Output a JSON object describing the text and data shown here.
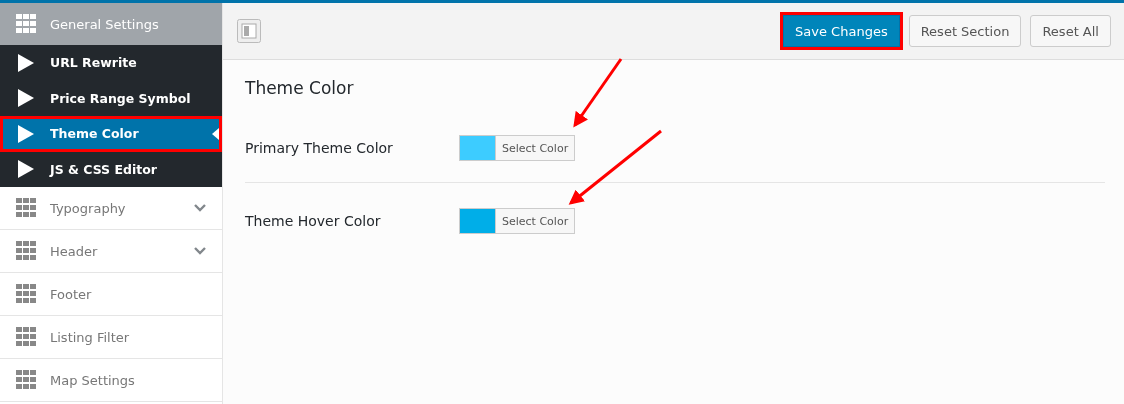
{
  "sidebar": {
    "sections": [
      {
        "label": "General Settings",
        "expanded": true,
        "has_submenu": true,
        "children": [
          {
            "label": "URL Rewrite",
            "selected": false,
            "highlighted": false
          },
          {
            "label": "Price Range Symbol",
            "selected": false,
            "highlighted": false
          },
          {
            "label": "Theme Color",
            "selected": true,
            "highlighted": true
          },
          {
            "label": "JS & CSS Editor",
            "selected": false,
            "highlighted": false
          }
        ]
      },
      {
        "label": "Typography",
        "expanded": false,
        "has_submenu": true
      },
      {
        "label": "Header",
        "expanded": false,
        "has_submenu": true
      },
      {
        "label": "Footer",
        "expanded": false,
        "has_submenu": false
      },
      {
        "label": "Listing Filter",
        "expanded": false,
        "has_submenu": false
      },
      {
        "label": "Map Settings",
        "expanded": false,
        "has_submenu": false
      }
    ]
  },
  "toolbar": {
    "buttons": [
      {
        "label": "Save Changes",
        "kind": "primary",
        "highlighted": true
      },
      {
        "label": "Reset Section",
        "kind": "secondary",
        "highlighted": false
      },
      {
        "label": "Reset All",
        "kind": "secondary",
        "highlighted": false
      }
    ]
  },
  "section": {
    "title": "Theme Color",
    "fields": [
      {
        "label": "Primary Theme Color",
        "color": "#3dccff",
        "button": "Select Color"
      },
      {
        "label": "Theme Hover Color",
        "color": "#00aee8",
        "button": "Select Color"
      }
    ]
  }
}
